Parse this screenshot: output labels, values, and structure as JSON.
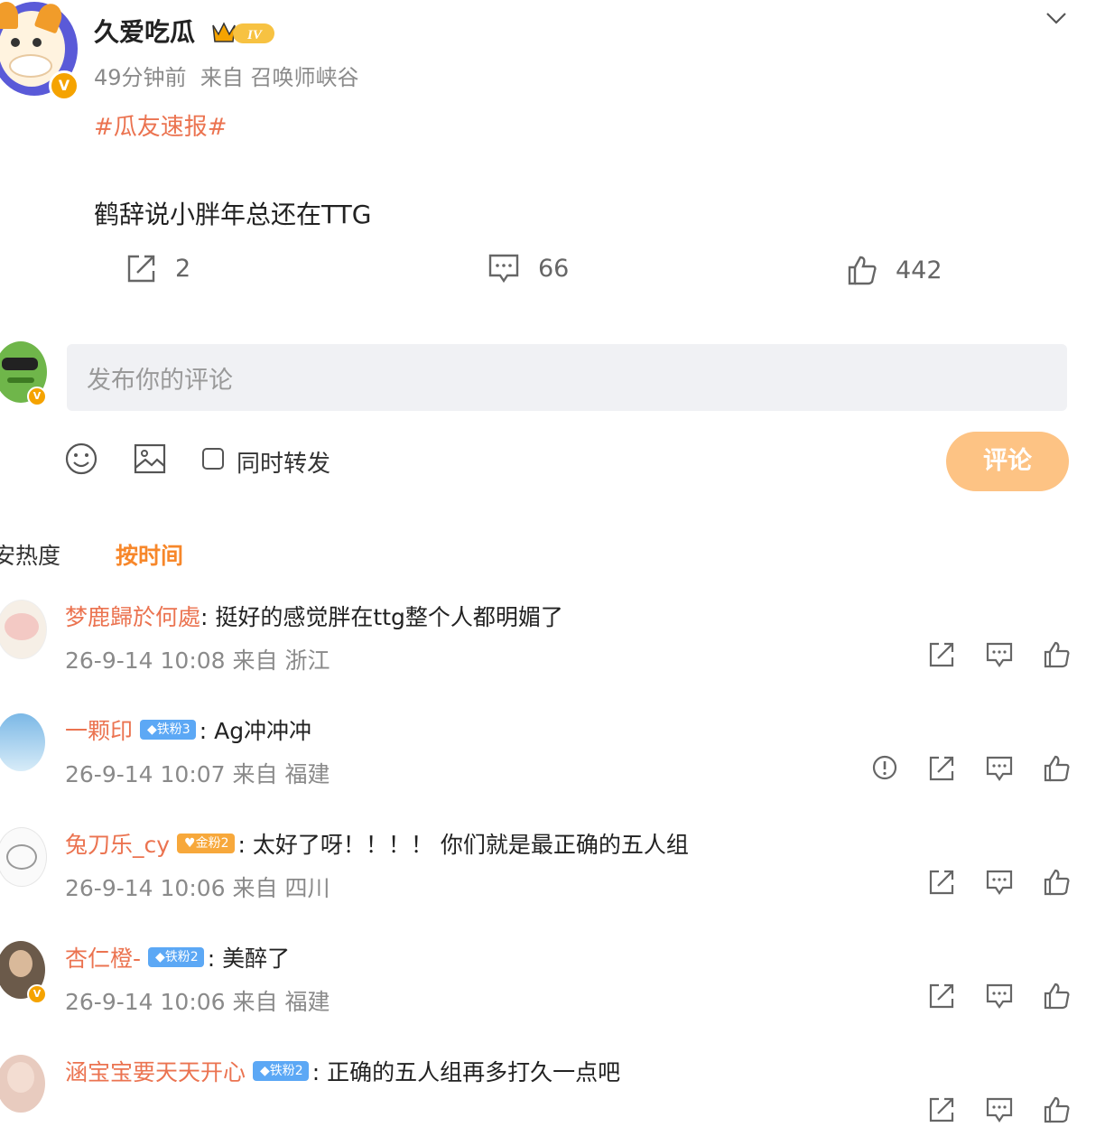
{
  "post": {
    "author": "久爱吃瓜",
    "level_badge": "IV",
    "time": "49分钟前",
    "source": "来自 召唤师峡谷",
    "hashtag": "#瓜友速报#",
    "content": "鹤辞说小胖年总还在TTG",
    "reposts": "2",
    "comments": "66",
    "likes": "442"
  },
  "composer": {
    "placeholder": "发布你的评论",
    "repost_label": "同时转发",
    "submit_label": "评论"
  },
  "sort": {
    "heat": "安热度",
    "time": "按时间"
  },
  "comments": [
    {
      "name": "梦鹿歸於何處",
      "badge": "",
      "text": ": 挺好的感觉胖在ttg整个人都明媚了",
      "time": "26-9-14 10:08",
      "source": "来自 浙江"
    },
    {
      "name": "一颗印",
      "badge": "铁粉3",
      "text": ": Ag冲冲冲",
      "time": "26-9-14 10:07",
      "source": "来自 福建"
    },
    {
      "name": "兔刀乐_cy",
      "badge": "金粉2",
      "text": ": 太好了呀！！！！ 你们就是最正确的五人组",
      "time": "26-9-14 10:06",
      "source": "来自 四川"
    },
    {
      "name": "杏仁橙-",
      "badge": "铁粉2",
      "text": ": 美醉了",
      "time": "26-9-14 10:06",
      "source": "来自 福建"
    },
    {
      "name": "涵宝宝要天天开心",
      "badge": "铁粉2",
      "text": ": 正确的五人组再多打久一点吧"
    }
  ],
  "colors": {
    "accent": "#eb7350",
    "orange": "#f7872a",
    "submit_bg": "#fdc384",
    "fan_blue": "#5ca8f5",
    "fan_gold": "#f7a83b"
  }
}
